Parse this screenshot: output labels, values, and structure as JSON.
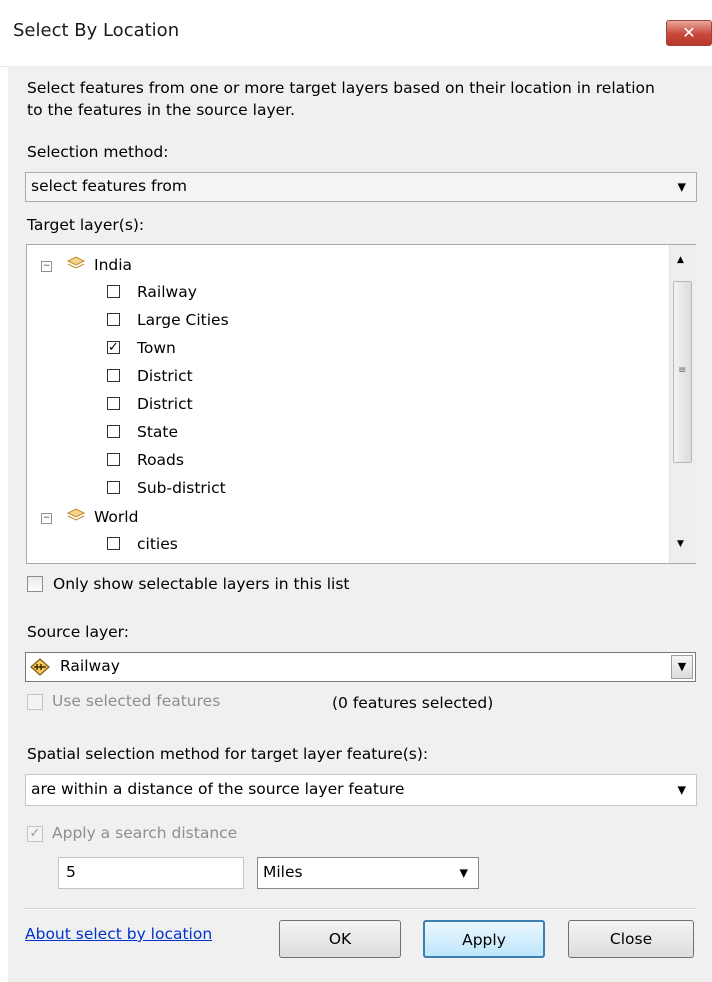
{
  "window": {
    "title": "Select By Location",
    "close_label": "✕"
  },
  "description": "Select features from one or more target layers based on their location in relation to the features in the source layer.",
  "selection_method": {
    "label": "Selection method:",
    "value": "select features from"
  },
  "target_layers": {
    "label": "Target layer(s):",
    "groups": [
      {
        "name": "India",
        "layers": [
          {
            "name": "Railway",
            "checked": false
          },
          {
            "name": "Large Cities",
            "checked": false
          },
          {
            "name": "Town",
            "checked": true
          },
          {
            "name": "District",
            "checked": false
          },
          {
            "name": "District",
            "checked": false
          },
          {
            "name": "State",
            "checked": false
          },
          {
            "name": "Roads",
            "checked": false
          },
          {
            "name": "Sub-district",
            "checked": false
          }
        ]
      },
      {
        "name": "World",
        "layers": [
          {
            "name": "cities",
            "checked": false
          }
        ]
      }
    ]
  },
  "only_selectable": {
    "label": "Only show selectable layers in this list",
    "checked": false
  },
  "source_layer": {
    "label": "Source layer:",
    "value": "Railway"
  },
  "use_selected": {
    "label": "Use selected features",
    "checked": false,
    "count_text": "(0 features selected)"
  },
  "spatial_method": {
    "label": "Spatial selection method for target layer feature(s):",
    "value": "are within a distance of the source layer feature"
  },
  "search_distance": {
    "label": "Apply a search distance",
    "checked": true,
    "value": "5",
    "units": "Miles"
  },
  "footer": {
    "link": "About select by location",
    "ok": "OK",
    "apply": "Apply",
    "close": "Close"
  }
}
